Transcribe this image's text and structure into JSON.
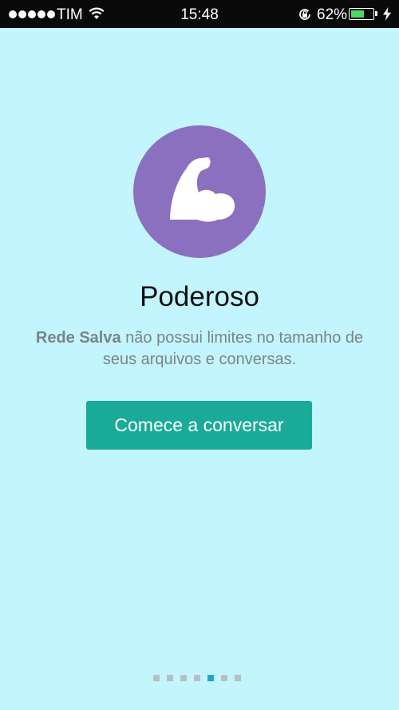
{
  "status_bar": {
    "carrier": "TIM",
    "time": "15:48",
    "battery_percent": "62%",
    "battery_level": 0.62,
    "signal_bars": 5,
    "icons": [
      "wifi-icon",
      "rotation-lock-icon",
      "battery-icon",
      "charging-bolt-icon"
    ]
  },
  "onboarding": {
    "hero_icon": "flexed-bicep-icon",
    "hero_color": "#8c70c0",
    "title": "Poderoso",
    "description_bold": "Rede Salva",
    "description_rest": " não possui limites no tamanho de seus arquivos e conversas.",
    "cta_label": "Comece a conversar",
    "cta_color": "#1aab98"
  },
  "pager": {
    "total": 7,
    "active_index": 4,
    "active_color": "#27a3c4"
  },
  "colors": {
    "background": "#c3f5fe",
    "status_bar": "#0a0a0a"
  }
}
